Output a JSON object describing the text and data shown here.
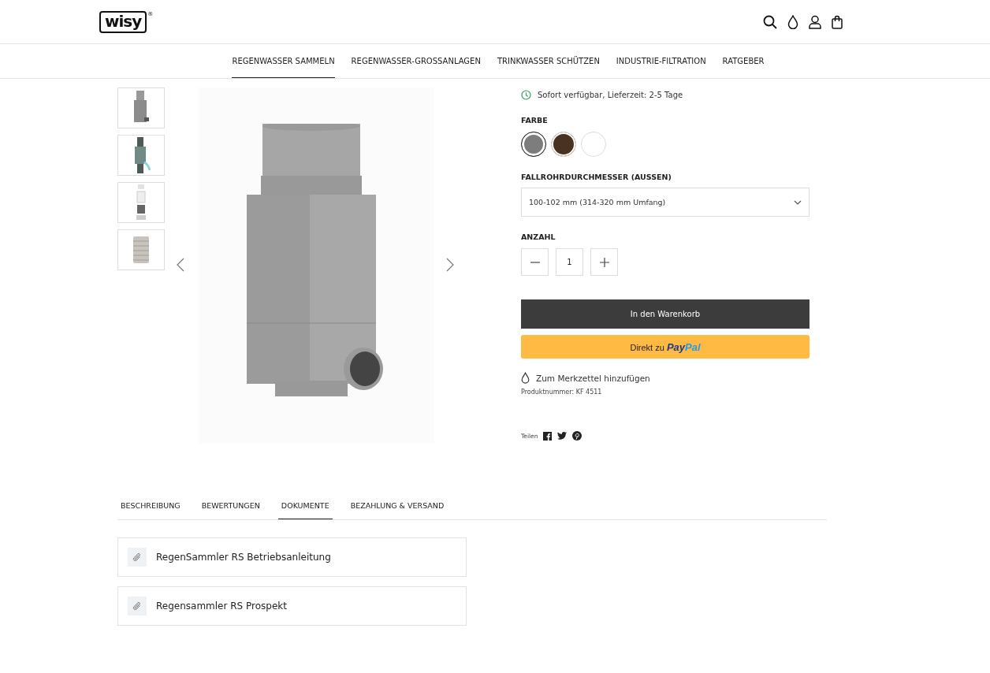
{
  "header": {
    "logo": "wisy",
    "logo_mark": "®"
  },
  "nav": [
    {
      "label": "REGENWASSER SAMMELN",
      "selected": true
    },
    {
      "label": "REGENWASSER-GROSSANLAGEN",
      "selected": false
    },
    {
      "label": "TRINKWASSER SCHÜTZEN",
      "selected": false
    },
    {
      "label": "INDUSTRIE-FILTRATION",
      "selected": false
    },
    {
      "label": "RATGEBER",
      "selected": false
    }
  ],
  "gallery": {
    "thumbnails": [
      {
        "kind": "collector"
      },
      {
        "kind": "pipe"
      },
      {
        "kind": "parts"
      },
      {
        "kind": "filter"
      }
    ]
  },
  "product": {
    "availability": "Sofort verfügbar, Lieferzeit: 2-5 Tage",
    "color_label": "FARBE",
    "colors": [
      {
        "color": "#7d7d7d",
        "selected": true
      },
      {
        "color": "#4a3222",
        "selected": false
      },
      {
        "color": "#ffffff",
        "selected": false
      }
    ],
    "diameter_label": "FALLROHRDURCHMESSER (AUSSEN)",
    "diameter_value": "100-102 mm (314-320 mm Umfang)",
    "quantity_label": "ANZAHL",
    "quantity": "1",
    "cart_button": "In den Warenkorb",
    "paypal_button": {
      "prefix": "Direkt zu",
      "brand_first": "Pay",
      "brand_second": "Pal"
    },
    "wishlist": "Zum Merkzettel hinzufügen",
    "product_number": "Produktnummer: KF 4511",
    "share_label": "Teilen"
  },
  "tabs": [
    {
      "label": "BESCHREIBUNG",
      "selected": false
    },
    {
      "label": "BEWERTUNGEN",
      "selected": false
    },
    {
      "label": "DOKUMENTE",
      "selected": true
    },
    {
      "label": "BEZAHLUNG & VERSAND",
      "selected": false
    }
  ],
  "documents": [
    {
      "title": "RegenSammler RS Betriebsanleitung"
    },
    {
      "title": "Regensammler RS Prospekt"
    }
  ]
}
